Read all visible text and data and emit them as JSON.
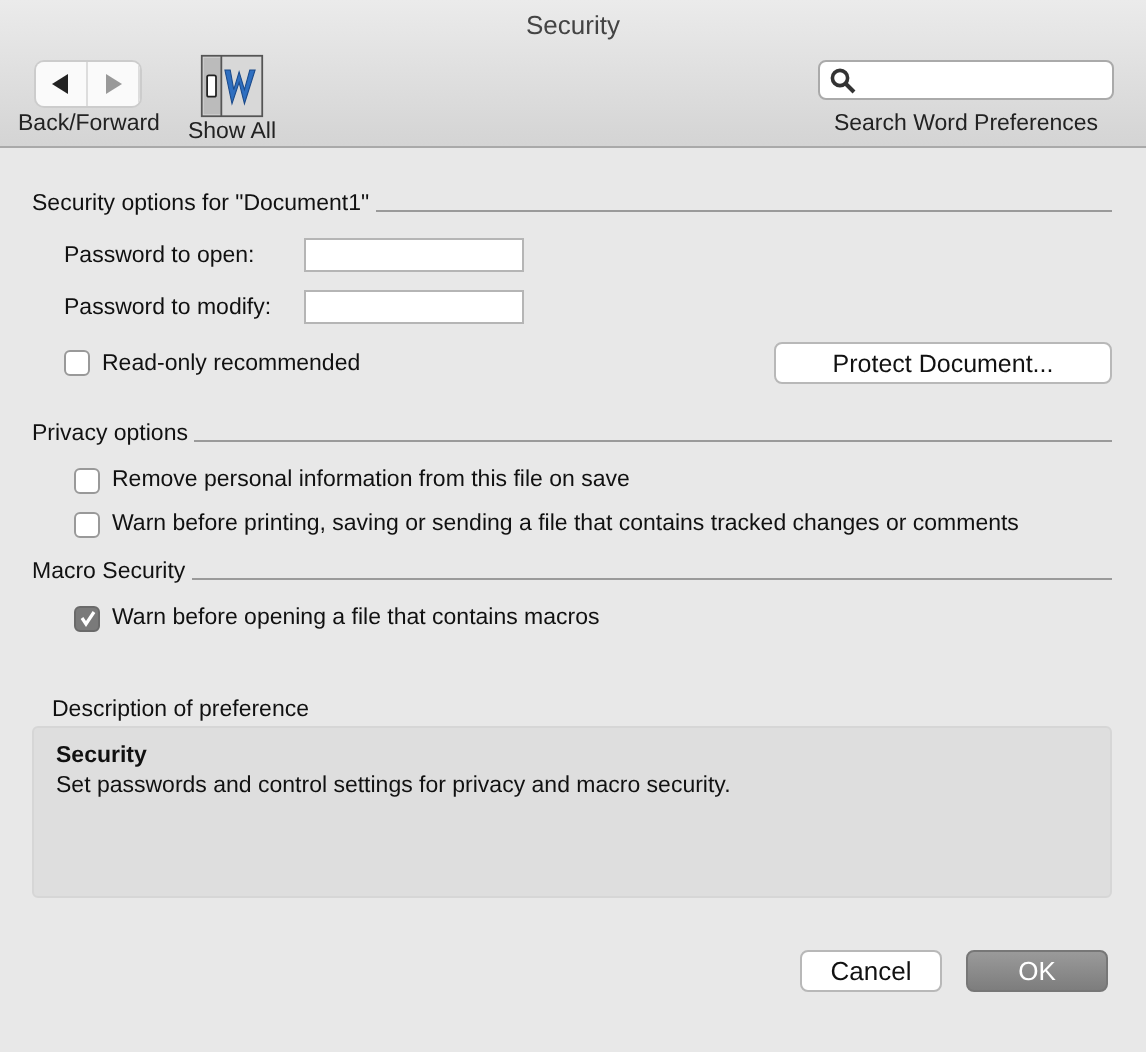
{
  "window": {
    "title": "Security"
  },
  "toolbar": {
    "back_forward_label": "Back/Forward",
    "show_all_label": "Show All",
    "search": {
      "label": "Search Word Preferences"
    }
  },
  "security_options": {
    "title": "Security options for \"Document1\"",
    "fields": [
      {
        "label": "Password to open:"
      },
      {
        "label": "Password to modify:"
      }
    ],
    "read_only": {
      "label": "Read-only recommended",
      "checked": false
    },
    "protect_button": "Protect Document..."
  },
  "privacy_options": {
    "title": "Privacy options",
    "checkboxes": [
      {
        "label": "Remove personal information from this file on save",
        "checked": false
      },
      {
        "label": "Warn before printing, saving or sending a file that contains tracked changes or comments",
        "checked": false
      }
    ]
  },
  "macro_security": {
    "title": "Macro Security",
    "checkboxes": [
      {
        "label": "Warn before opening a file that contains macros",
        "checked": true
      }
    ]
  },
  "description": {
    "label": "Description of preference",
    "title": "Security",
    "text": "Set passwords and control settings for privacy and macro security."
  },
  "buttons": [
    {
      "label": "Cancel",
      "kind": "normal"
    },
    {
      "label": "OK",
      "kind": "default"
    }
  ]
}
